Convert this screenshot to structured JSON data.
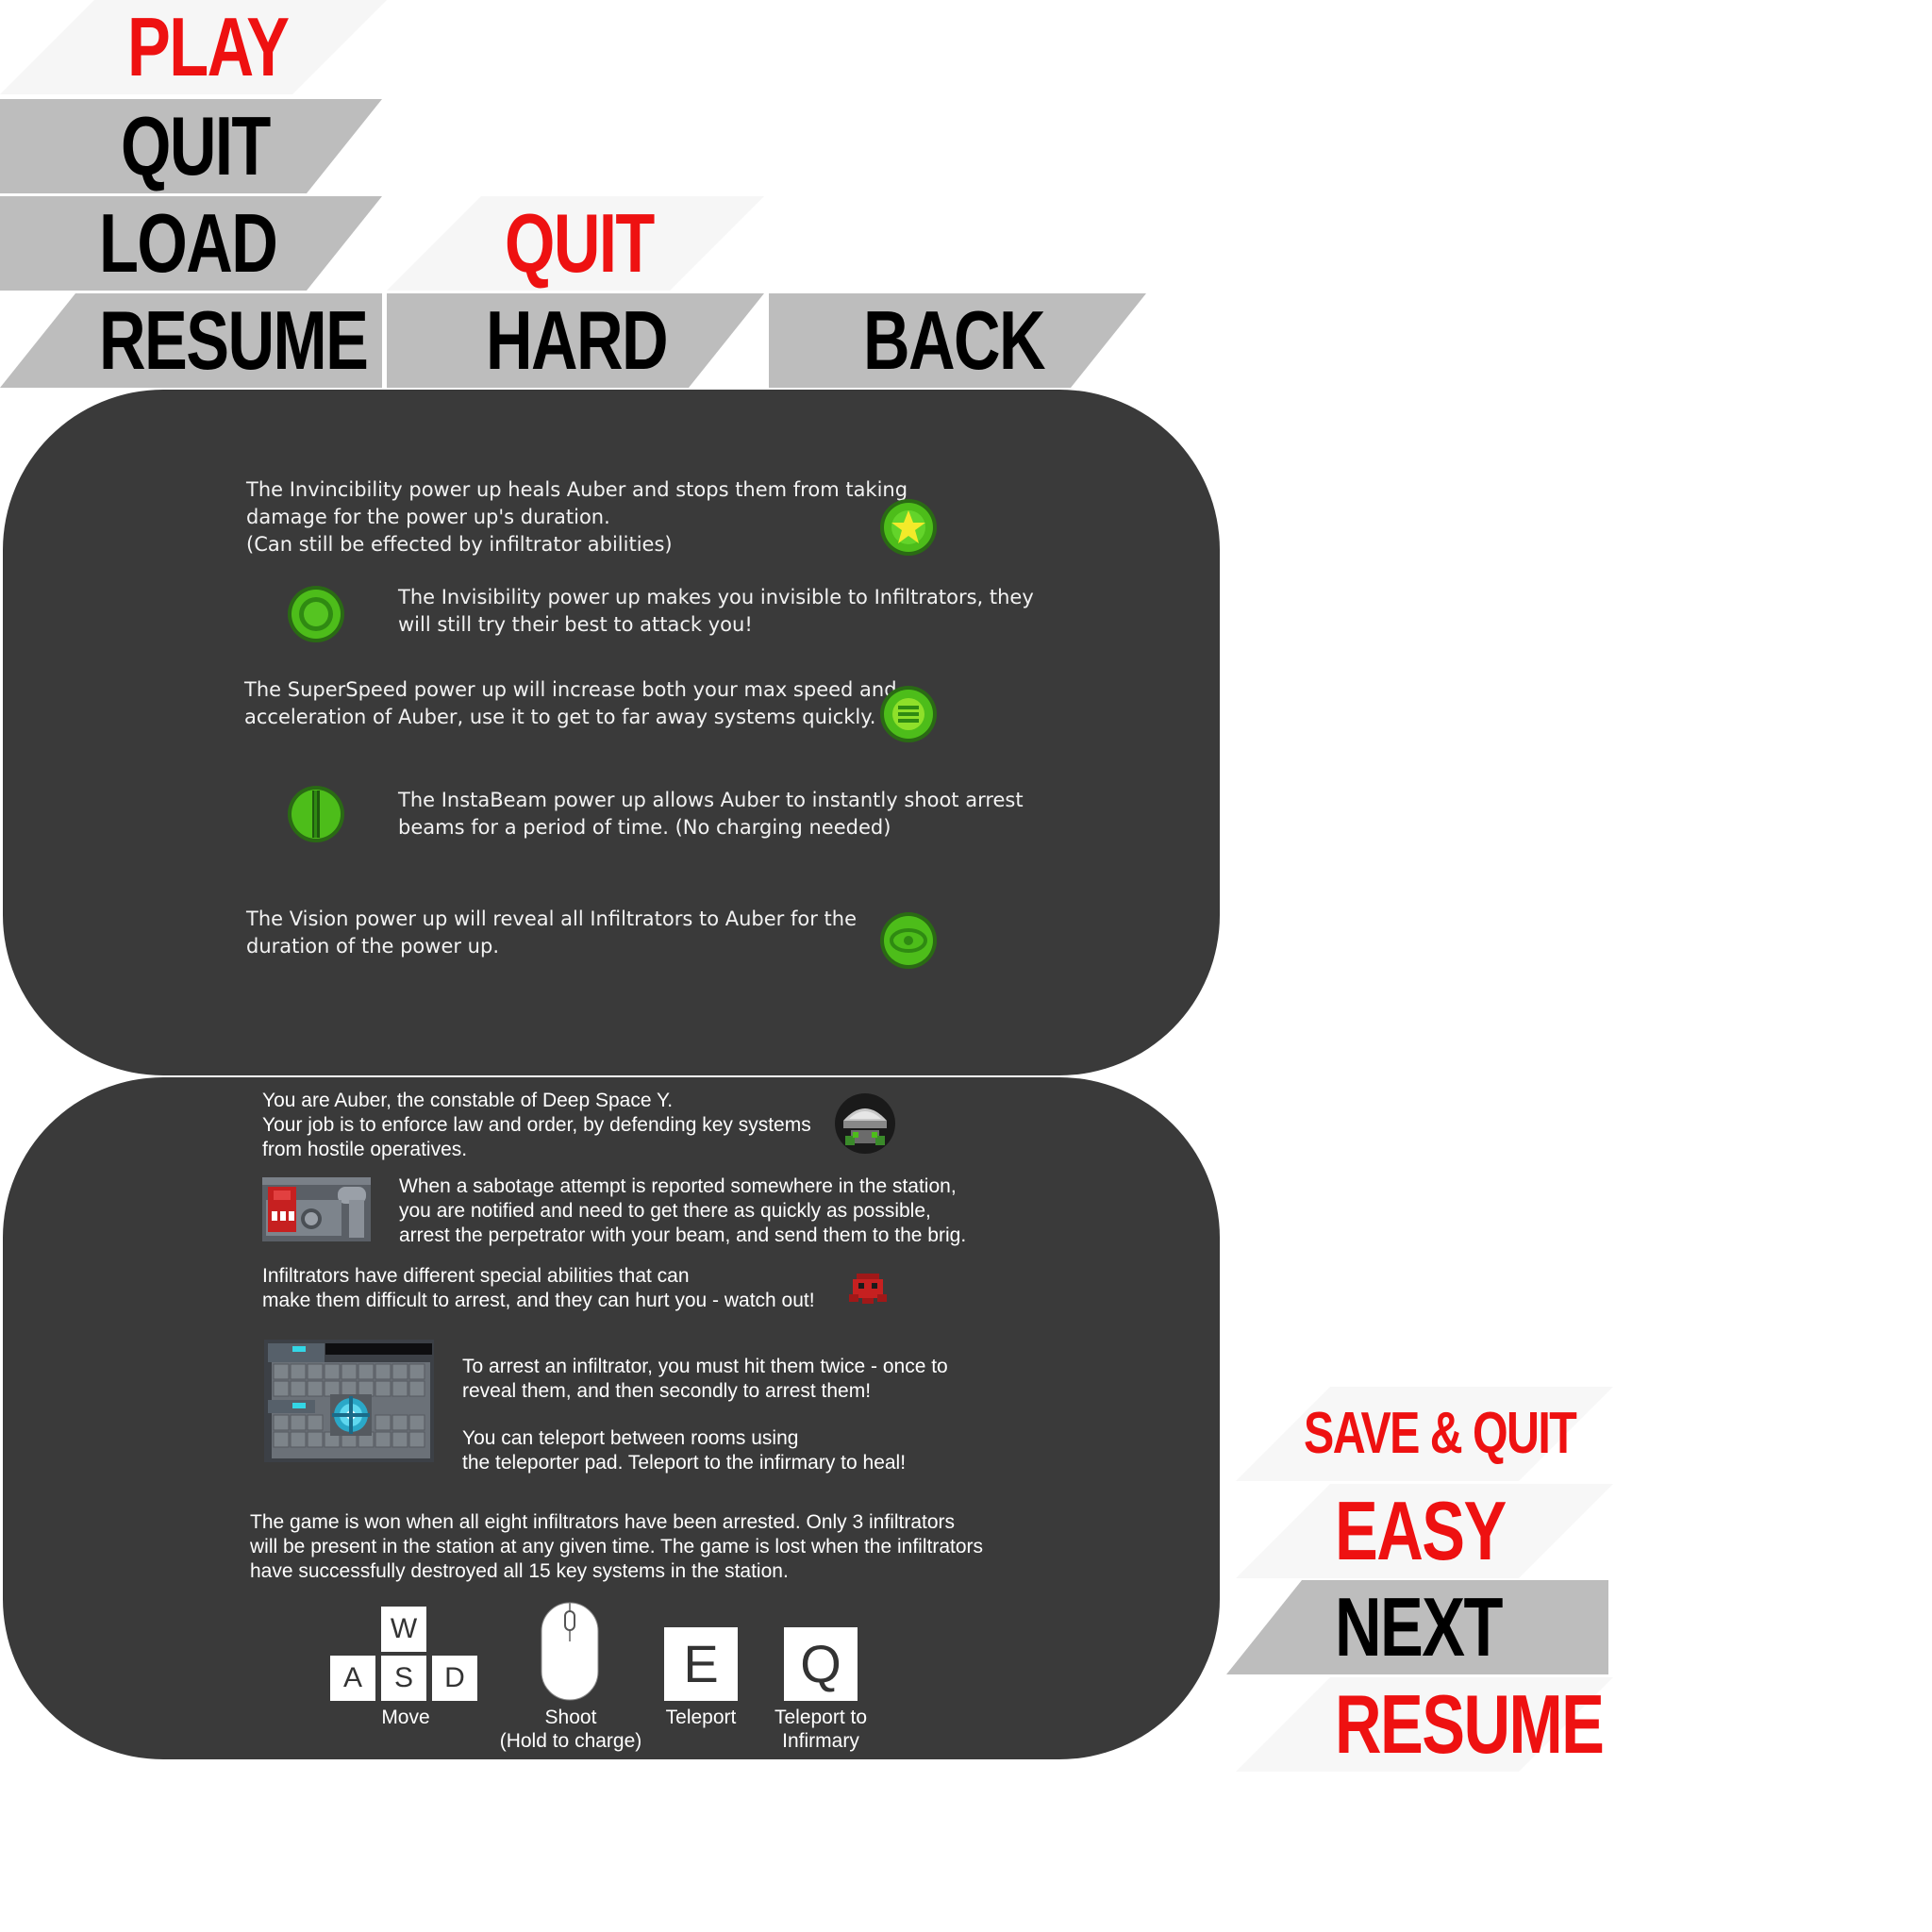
{
  "buttons": {
    "play": "PLAY",
    "quit_1": "QUIT",
    "load": "LOAD",
    "resume_1": "RESUME",
    "quit_2": "QUIT",
    "hard": "HARD",
    "back": "BACK",
    "save_quit": "SAVE & QUIT",
    "easy": "EASY",
    "next": "NEXT",
    "resume_2": "RESUME"
  },
  "powerups": {
    "invincibility": [
      "The Invincibility power up heals Auber and stops them from taking",
      "damage for the power up's duration.",
      "(Can still be effected by infiltrator abilities)"
    ],
    "invisibility": [
      "The Invisibility power up makes you invisible to Infiltrators, they",
      "will still try their best to attack you!"
    ],
    "superspeed": [
      "The SuperSpeed power up will increase both your max speed and",
      "acceleration of Auber, use it to get to far away systems quickly."
    ],
    "instabeam": [
      "The InstaBeam power up allows Auber to instantly shoot arrest",
      "beams for a period of time. (No charging needed)"
    ],
    "vision": [
      "The Vision power up will reveal all Infiltrators to Auber for the",
      "duration of the power up."
    ]
  },
  "howto": {
    "intro": [
      "You are Auber, the constable of Deep Space Y.",
      "Your job is to enforce law and order, by defending key systems",
      "from hostile operatives."
    ],
    "sabotage": [
      "When a sabotage attempt is reported somewhere in the station,",
      "you are notified and need to get there as quickly as possible,",
      "arrest the perpetrator with your beam, and send them to the brig."
    ],
    "abilities": [
      "Infiltrators have different special abilities that can",
      "make them difficult to arrest, and they can hurt you - watch out!"
    ],
    "arrest": [
      "To arrest an infiltrator, you must hit them twice - once to",
      "reveal them, and then secondly to arrest them!"
    ],
    "teleport": [
      "You can teleport between rooms using",
      "the teleporter pad. Teleport to the infirmary to heal!"
    ],
    "win": [
      "The game is won when all eight infiltrators have been arrested. Only 3 infiltrators",
      "will be present in the station at any given time. The game is lost when the infiltrators",
      "have successfully destroyed all 15 key systems in the station."
    ]
  },
  "controls": {
    "keys": {
      "w": "W",
      "a": "A",
      "s": "S",
      "d": "D",
      "e": "E",
      "q": "Q"
    },
    "move": "Move",
    "shoot": "Shoot",
    "shoot_hint": "(Hold to charge)",
    "teleport": "Teleport",
    "infirmary_1": "Teleport to",
    "infirmary_2": "Infirmary"
  },
  "icons": {
    "invincibility": "star-powerup-icon",
    "invisibility": "ring-powerup-icon",
    "superspeed": "lines-powerup-icon",
    "instabeam": "beam-powerup-icon",
    "vision": "eye-powerup-icon",
    "auber": "auber-sprite",
    "sabotage": "sabotage-sprite",
    "infiltrator": "infiltrator-sprite",
    "teleporter": "teleporter-room-sprite",
    "mouse": "mouse-icon"
  },
  "colors": {
    "accent_red": "#ee1111",
    "bar_gray": "#bdbdbd",
    "panel": "#3a3a3a",
    "powerup_green": "#4dbd1a"
  }
}
